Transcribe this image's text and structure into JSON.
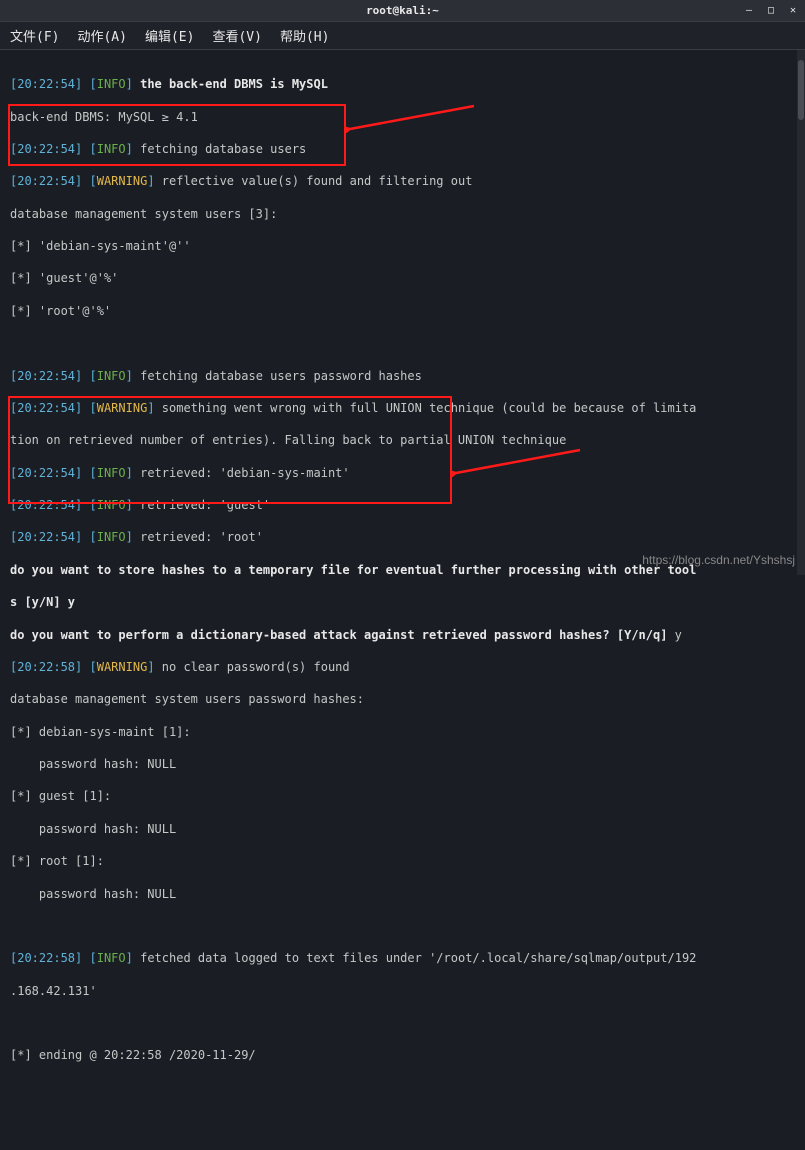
{
  "window": {
    "title": "root@kali:~"
  },
  "menu": {
    "file": "文件(F)",
    "action": "动作(A)",
    "edit": "编辑(E)",
    "view": "查看(V)",
    "help": "帮助(H)"
  },
  "colors": {
    "timestamp": "#5fb3d9",
    "info": "#6ab04c",
    "warning": "#e1b84a",
    "highlight_box": "#ff1a1a"
  },
  "lines": {
    "l1_ts": "20:22:54",
    "l1_lvl": "INFO",
    "l1_msg": "the back-end DBMS is MySQL",
    "l2": "back-end DBMS: MySQL ≥ 4.1",
    "l3_ts": "20:22:54",
    "l3_lvl": "INFO",
    "l3_msg": " fetching database users",
    "l4_ts": "20:22:54",
    "l4_lvl": "WARNING",
    "l4_msg": " reflective value(s) found and filtering out",
    "l5": "database management system users [3]:",
    "l6": "[*] 'debian-sys-maint'@''",
    "l7": "[*] 'guest'@'%'",
    "l8": "[*] 'root'@'%'",
    "l9_ts": "20:22:54",
    "l9_lvl": "INFO",
    "l9_msg": " fetching database users password hashes",
    "l10_ts": "20:22:54",
    "l10_lvl": "WARNING",
    "l10_msg": " something went wrong with full UNION technique (could be because of limita",
    "l10b": "tion on retrieved number of entries). Falling back to partial UNION technique",
    "l11_ts": "20:22:54",
    "l11_lvl": "INFO",
    "l11_msg": " retrieved: 'debian-sys-maint'",
    "l12_ts": "20:22:54",
    "l12_lvl": "INFO",
    "l12_msg": " retrieved: 'guest'",
    "l13_ts": "20:22:54",
    "l13_lvl": "INFO",
    "l13_msg": " retrieved: 'root'",
    "l14": "do you want to store hashes to a temporary file for eventual further processing with other tool",
    "l14b": "s [y/N] y",
    "l15": "do you want to perform a dictionary-based attack against retrieved password hashes? [Y/n/q]",
    "l15_ans": " y",
    "l16_ts": "20:22:58",
    "l16_lvl": "WARNING",
    "l16_msg": " no clear password(s) found",
    "l17": "database management system users password hashes:",
    "l18": "[*] debian-sys-maint [1]:",
    "l19": "    password hash: NULL",
    "l20": "[*] guest [1]:",
    "l21": "    password hash: NULL",
    "l22": "[*] root [1]:",
    "l23": "    password hash: NULL",
    "l24_ts": "20:22:58",
    "l24_lvl": "INFO",
    "l24_msg": " fetched data logged to text files under '/root/.local/share/sqlmap/output/192",
    "l24b": ".168.42.131'",
    "l25": "[*] ending @ 20:22:58 /2020-11-29/"
  },
  "watermark": "https://blog.csdn.net/Yshshsj"
}
